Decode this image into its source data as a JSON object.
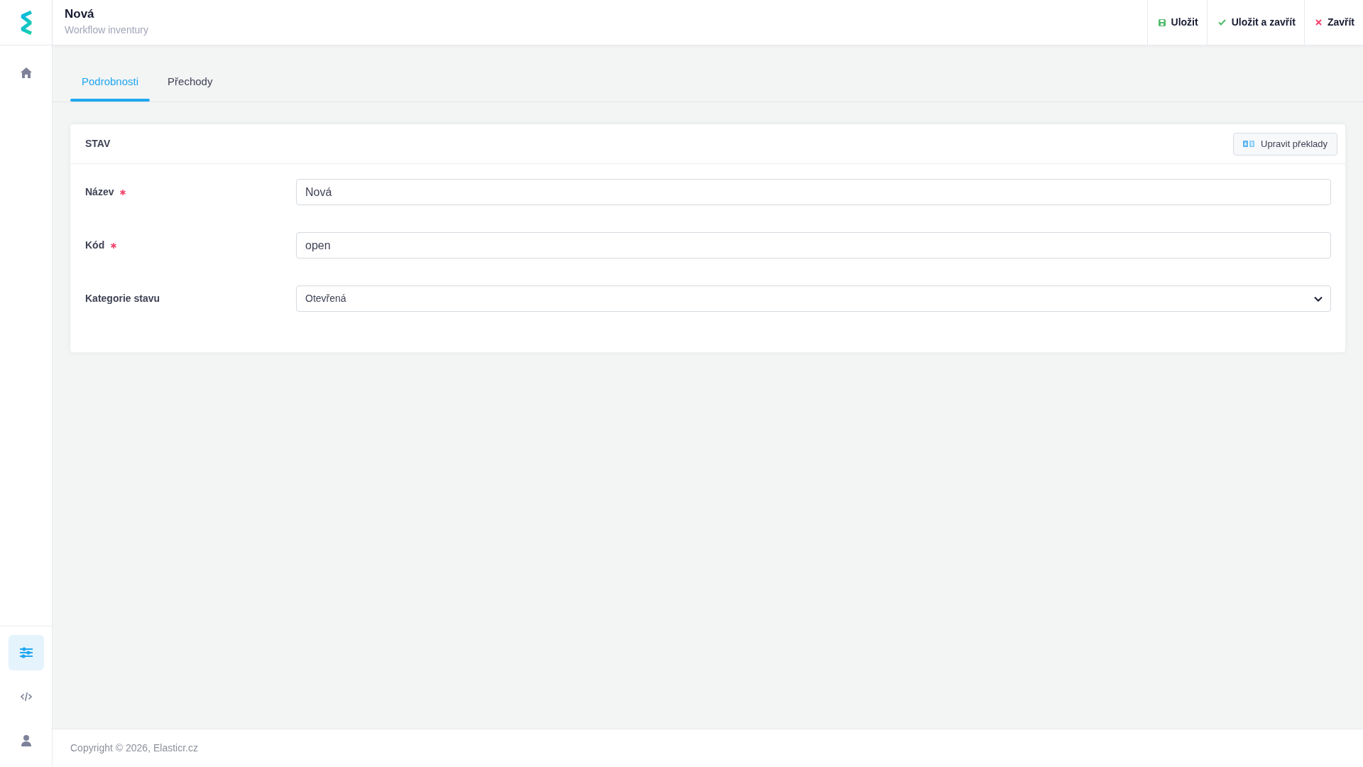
{
  "sidebar": {
    "top": [
      {
        "selected": false
      }
    ],
    "bottom": [
      {
        "selected": true
      },
      {
        "selected": false
      },
      {
        "selected": false
      }
    ]
  },
  "header": {
    "title": "Nová",
    "subtitle": "Workflow inventury",
    "actions": [
      {
        "label": "Uložit",
        "kind": "save"
      },
      {
        "label": "Uložit a zavřít",
        "kind": "save-close"
      },
      {
        "label": "Zavřít",
        "kind": "close"
      }
    ]
  },
  "tabs": [
    {
      "label": "Podrobnosti",
      "selected": true
    },
    {
      "label": "Přechody",
      "selected": false
    }
  ],
  "card": {
    "title": "STAV",
    "button": "Upravit překlady",
    "fields": [
      {
        "label": "Název",
        "required": true,
        "kind": "text",
        "value": "Nová"
      },
      {
        "label": "Kód",
        "required": true,
        "kind": "text",
        "value": "open"
      },
      {
        "label": "Kategorie stavu",
        "required": false,
        "kind": "select",
        "value": "Otevřená"
      }
    ]
  },
  "footer": {
    "copyright": "Copyright © 2026, Elasticr.cz"
  }
}
